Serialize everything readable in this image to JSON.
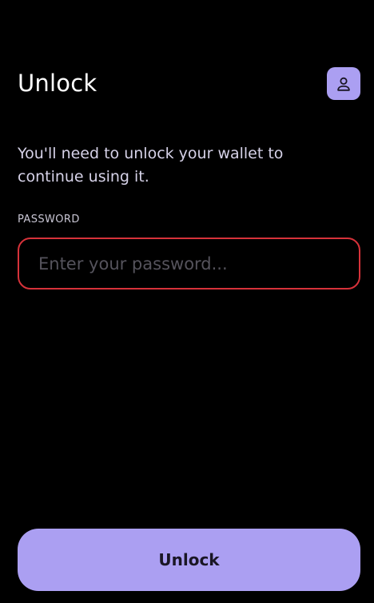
{
  "header": {
    "title": "Unlock",
    "avatar_icon": "user-icon"
  },
  "main": {
    "subtitle": "You'll need to unlock your wallet to continue using it.",
    "password": {
      "label": "PASSWORD",
      "value": "",
      "placeholder": "Enter your password..."
    }
  },
  "footer": {
    "unlock_label": "Unlock"
  },
  "colors": {
    "background": "#000000",
    "accent": "#ab9ff2",
    "error_border": "#d6323a",
    "button_text": "#1a1625"
  }
}
